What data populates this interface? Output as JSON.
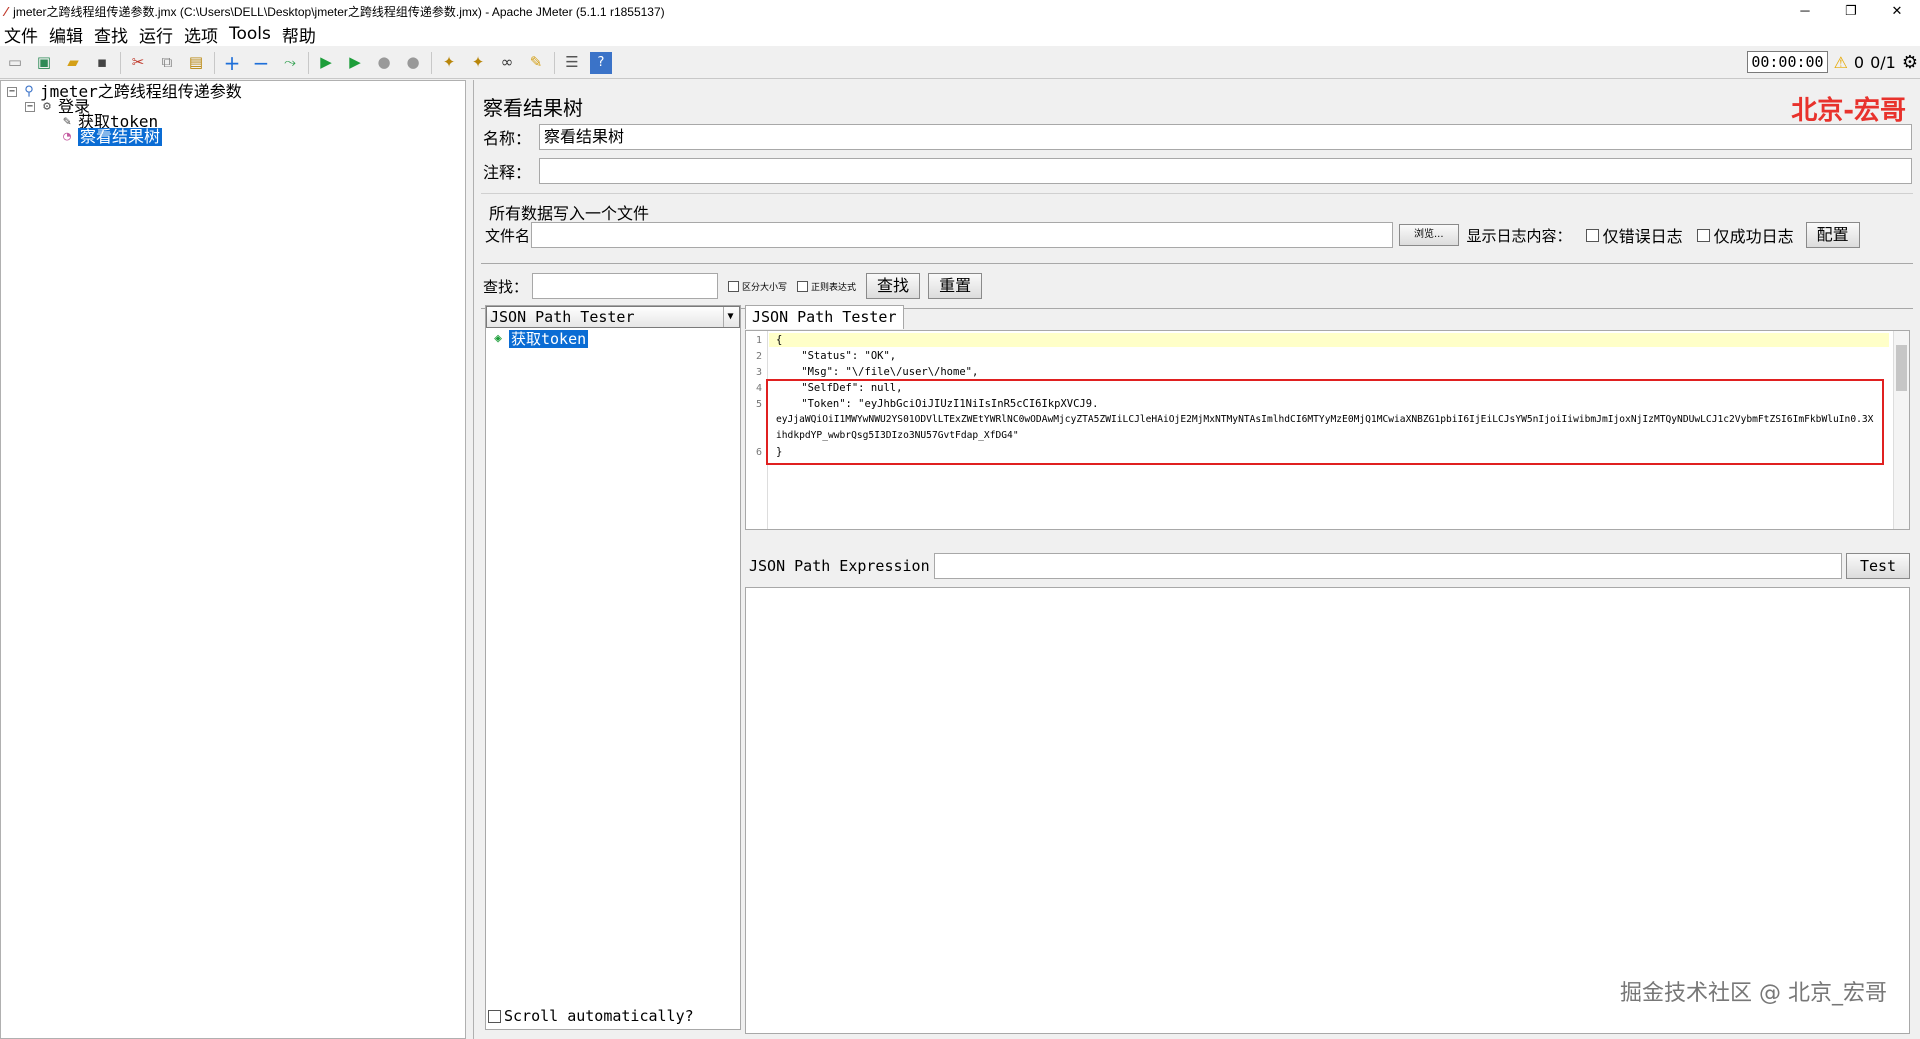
{
  "window": {
    "title": "jmeter之跨线程组传递参数.jmx (C:\\Users\\DELL\\Desktop\\jmeter之跨线程组传递参数.jmx) - Apache JMeter (5.1.1 r1855137)",
    "minimize": "─",
    "maximize": "❐",
    "close": "✕"
  },
  "menu": [
    "文件",
    "编辑",
    "查找",
    "运行",
    "选项",
    "Tools",
    "帮助"
  ],
  "toolbar": {
    "timer": "00:00:00",
    "warning_count": "0",
    "threads": "0/1"
  },
  "tree": {
    "root": "jmeter之跨线程组传递参数",
    "group": "登录",
    "sampler": "获取token",
    "listener": "察看结果树"
  },
  "panel": {
    "title": "察看结果树",
    "brand": "北京-宏哥",
    "name_label": "名称：",
    "name_value": "察看结果树",
    "comment_label": "注释：",
    "file_group": "所有数据写入一个文件",
    "file_label": "文件名",
    "browse": "浏览...",
    "log_label": "显示日志内容：",
    "errors_only": "仅错误日志",
    "success_only": "仅成功日志",
    "configure": "配置"
  },
  "search": {
    "label": "查找：",
    "case_sensitive": "区分大小写",
    "regex": "正则表达式",
    "find_button": "查找",
    "reset_button": "重置"
  },
  "results": {
    "renderer": "JSON Path Tester",
    "sample": "获取token",
    "scroll_auto": "Scroll automatically?",
    "tab": "JSON Path Tester",
    "response_lines": [
      "{",
      "    \"Status\": \"OK\",",
      "    \"Msg\": \"\\/file\\/user\\/home\",",
      "    \"SelfDef\": null,",
      "    \"Token\": \"eyJhbGciOiJIUzI1NiIsInR5cCI6IkpXVCJ9.",
      "eyJjaWQiOiI1MWYwNWU2YS01ODVlLTExZWEtYWRlNC0wODAwMjcyZTA5ZWIiLCJleHAiOjE2MjMxNTMyNTAsImlhdCI6MTYyMzE0MjQ1MCwiaXNBZG1pbiI6IjEiLCJsYW5nIjoiIiwibmJmIjoxNjIzMTQyNDUwLCJ1c2VybmFtZSI6ImFkbWluIn0.3XihdkpdYP_wwbrQsg5I3DIzo3NU57GvtFdap_XfDG4\"",
      "}"
    ],
    "line_numbers": [
      "1",
      "2",
      "3",
      "4",
      "5",
      "6"
    ],
    "expression_label": "JSON Path Expression",
    "test_button": "Test"
  },
  "watermark": "掘金技术社区 @ 北京_宏哥"
}
